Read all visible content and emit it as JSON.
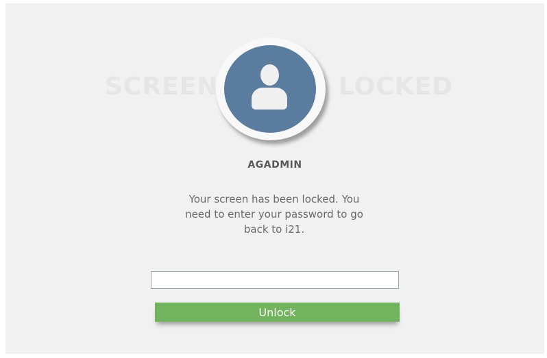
{
  "lock_screen": {
    "bg_left_word": "SCREEN",
    "bg_right_word": "LOCKED",
    "avatar_icon": "user-icon",
    "username": "AGADMIN",
    "message": "Your screen has been locked. You need to enter your password to go back to i21.",
    "password": {
      "value": "",
      "placeholder": ""
    },
    "unlock_label": "Unlock"
  },
  "colors": {
    "background": "#f1f1f1",
    "avatar": "#5a7d9f",
    "button": "#72b45e"
  }
}
